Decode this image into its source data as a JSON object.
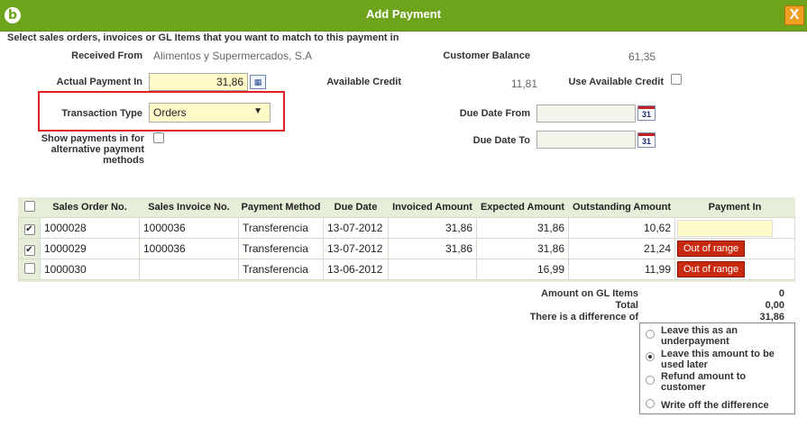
{
  "window": {
    "title": "Add Payment",
    "close_glyph": "X",
    "logo_glyph": "b"
  },
  "intro": "Select sales orders, invoices or GL Items that you want to match to this payment in",
  "form": {
    "received_from_label": "Received From",
    "received_from_value": "Alimentos y Supermercados, S.A",
    "customer_balance_label": "Customer Balance",
    "customer_balance_value": "61,35",
    "actual_payment_label": "Actual Payment In",
    "actual_payment_value": "31,86",
    "available_credit_label": "Available Credit",
    "available_credit_value": "11,81",
    "use_available_credit_label": "Use Available Credit",
    "transaction_type_label": "Transaction Type",
    "transaction_type_value": "Orders",
    "due_date_from_label": "Due Date From",
    "due_date_to_label": "Due Date To",
    "alt_methods_label_1": "Show payments in for",
    "alt_methods_label_2": "alternative payment",
    "alt_methods_label_3": "methods",
    "calendar_glyph": "31"
  },
  "table": {
    "headers": [
      "Sales Order No.",
      "Sales Invoice No.",
      "Payment Method",
      "Due Date",
      "Invoiced Amount",
      "Expected Amount",
      "Outstanding Amount",
      "Payment In"
    ],
    "rows": [
      {
        "checked": "✔",
        "order": "1000028",
        "invoice": "1000036",
        "method": "Transferencia",
        "due": "13-07-2012",
        "invoiced": "31,86",
        "expected": "31,86",
        "outstanding": "10,62",
        "status": ""
      },
      {
        "checked": "✔",
        "order": "1000029",
        "invoice": "1000036",
        "method": "Transferencia",
        "due": "13-07-2012",
        "invoiced": "31,86",
        "expected": "31,86",
        "outstanding": "21,24",
        "status": "Out of range"
      },
      {
        "checked": "",
        "order": "1000030",
        "invoice": "",
        "method": "Transferencia",
        "due": "13-06-2012",
        "invoiced": "",
        "expected": "16,99",
        "outstanding": "11,99",
        "status": "Out of range"
      }
    ]
  },
  "summary": {
    "gl_label": "Amount on GL Items",
    "gl_value": "0",
    "total_label": "Total",
    "total_value": "0,00",
    "diff_label": "There is a difference of",
    "diff_value": "31,86"
  },
  "options": {
    "underpayment_1": "Leave this as an",
    "underpayment_2": "underpayment",
    "later_1": "Leave this amount to be",
    "later_2": "used later",
    "refund_1": "Refund amount to",
    "refund_2": "customer",
    "writeoff": "Write off the difference",
    "selected": "later"
  }
}
